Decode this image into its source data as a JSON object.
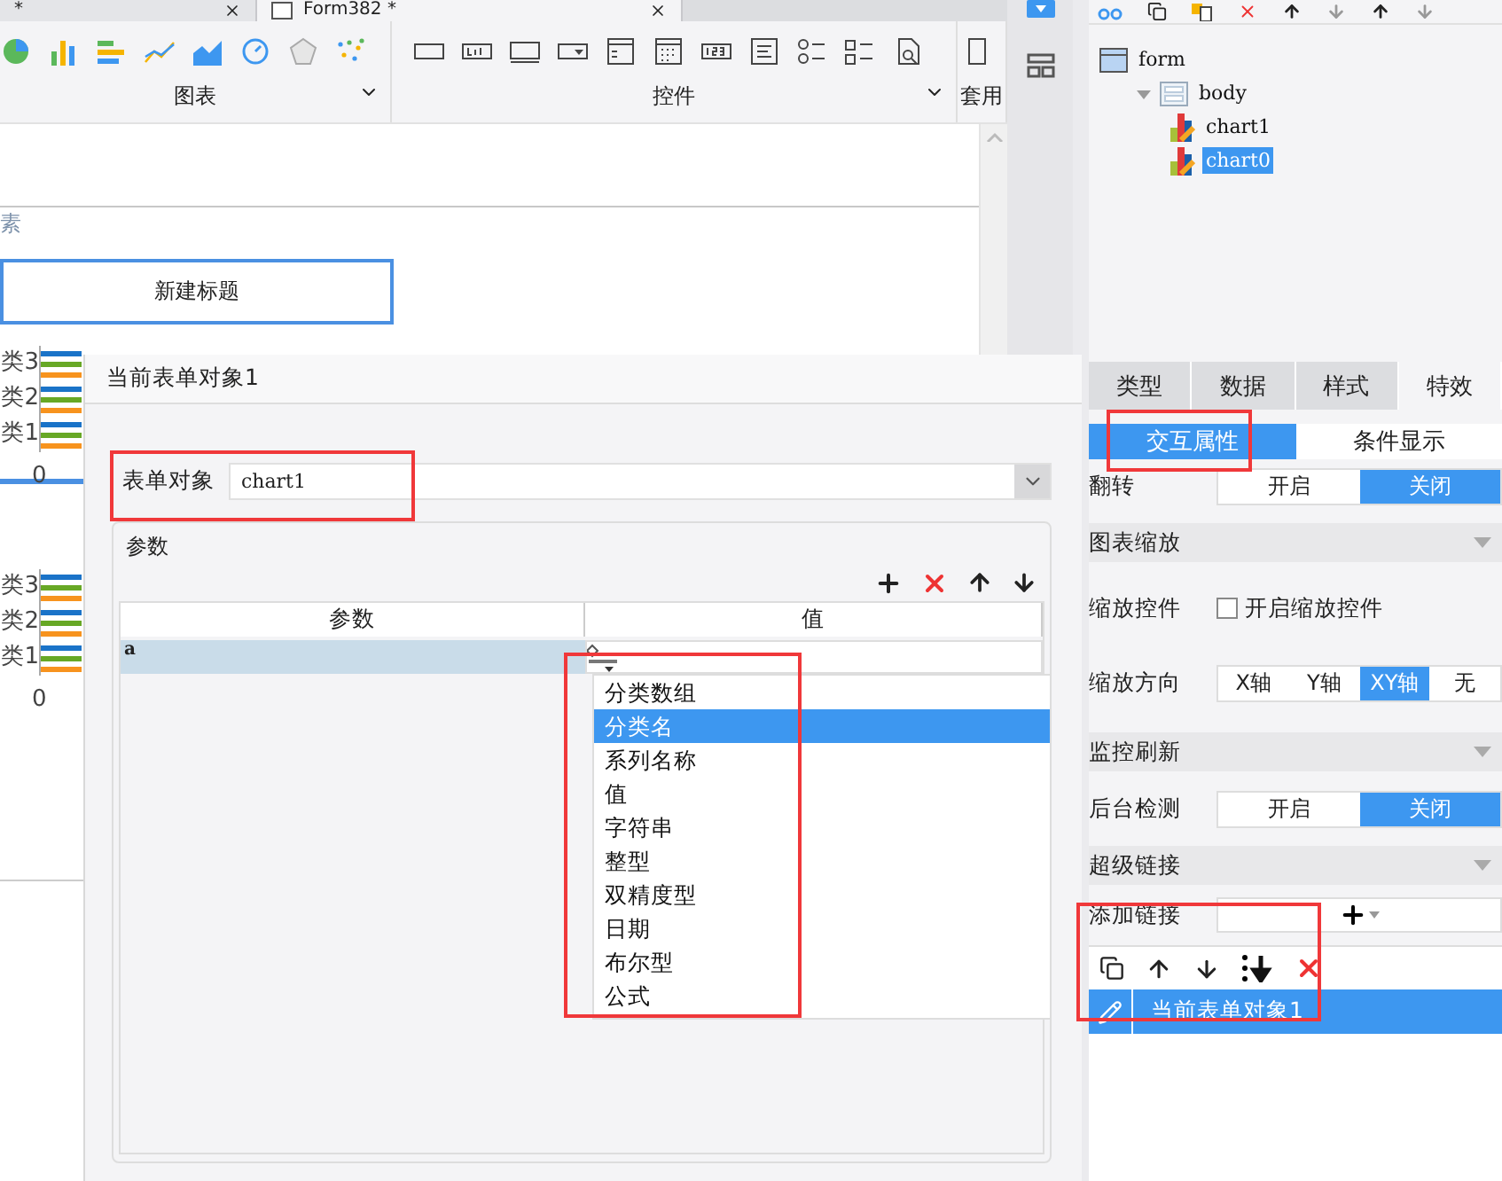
{
  "editor_tabs": [
    {
      "label": "*",
      "selected": false
    },
    {
      "label": "Form382 *",
      "selected": true
    }
  ],
  "ribbon": {
    "groups": [
      {
        "label": "图表"
      },
      {
        "label": "控件"
      },
      {
        "label": "套用"
      }
    ]
  },
  "canvas": {
    "hint": "素",
    "chart_title": "新建标题",
    "charts": [
      {
        "categories": [
          "类3",
          "类2",
          "类1"
        ],
        "axis_label": "0"
      },
      {
        "categories": [
          "类3",
          "类2",
          "类1"
        ],
        "axis_label": "0"
      }
    ]
  },
  "dialog": {
    "title": "当前表单对象1",
    "form_object": {
      "label": "表单对象",
      "value": "chart1"
    },
    "params": {
      "legend": "参数",
      "columns": [
        "参数",
        "值"
      ],
      "rows": [
        {
          "name": "a",
          "selected": true
        }
      ],
      "type_menu": [
        {
          "label": "分类数组",
          "selected": false
        },
        {
          "label": "分类名",
          "selected": true
        },
        {
          "label": "系列名称",
          "selected": false
        },
        {
          "label": "值",
          "selected": false
        },
        {
          "label": "字符串",
          "selected": false
        },
        {
          "label": "整型",
          "selected": false
        },
        {
          "label": "双精度型",
          "selected": false
        },
        {
          "label": "日期",
          "selected": false
        },
        {
          "label": "布尔型",
          "selected": false
        },
        {
          "label": "公式",
          "selected": false
        }
      ]
    }
  },
  "tree": [
    {
      "label": "form",
      "kind": "form",
      "selected": false,
      "children": [
        {
          "label": "body",
          "kind": "body",
          "selected": false,
          "expanded": true,
          "children": [
            {
              "label": "chart1",
              "kind": "chart",
              "selected": false
            },
            {
              "label": "chart0",
              "kind": "chart",
              "selected": true
            }
          ]
        }
      ]
    }
  ],
  "property_tabs": [
    {
      "label": "类型",
      "selected": false
    },
    {
      "label": "数据",
      "selected": false
    },
    {
      "label": "样式",
      "selected": false
    },
    {
      "label": "特效",
      "selected": true
    }
  ],
  "sub_tabs": [
    {
      "label": "交互属性",
      "selected": true
    },
    {
      "label": "条件显示",
      "selected": false
    }
  ],
  "settings": [
    {
      "kind": "toggle",
      "label": "翻转",
      "options": [
        {
          "label": "开启",
          "selected": false
        },
        {
          "label": "关闭",
          "selected": true
        }
      ]
    },
    {
      "kind": "section",
      "label": "图表缩放"
    },
    {
      "kind": "checkbox",
      "label": "缩放控件",
      "text": "开启缩放控件",
      "checked": false
    },
    {
      "kind": "toggle",
      "label": "缩放方向",
      "options": [
        {
          "label": "X轴",
          "selected": false
        },
        {
          "label": "Y轴",
          "selected": false
        },
        {
          "label": "XY轴",
          "selected": true
        },
        {
          "label": "无",
          "selected": false
        }
      ]
    },
    {
      "kind": "section",
      "label": "监控刷新"
    },
    {
      "kind": "toggle",
      "label": "后台检测",
      "options": [
        {
          "label": "开启",
          "selected": false
        },
        {
          "label": "关闭",
          "selected": true
        }
      ]
    },
    {
      "kind": "section",
      "label": "超级链接"
    },
    {
      "kind": "add",
      "label": "添加链接"
    }
  ],
  "hyperlinks": [
    {
      "label": "当前表单对象1",
      "selected": true
    }
  ]
}
